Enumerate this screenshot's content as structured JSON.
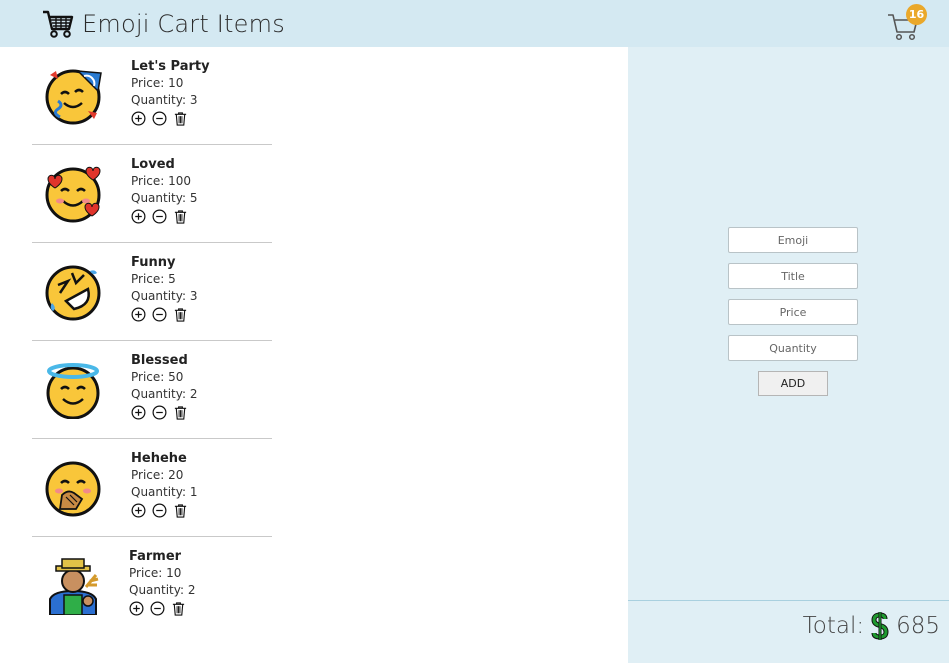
{
  "header": {
    "title": "Emoji Cart Items",
    "cart_count": "16",
    "brand_icon": "shopping-cart-icon",
    "cart_icon": "cart-outline-icon"
  },
  "items": [
    {
      "name": "Let's Party",
      "price": "Price: 10",
      "quantity": "Quantity: 3",
      "icon": "party-face-icon"
    },
    {
      "name": "Loved",
      "price": "Price: 100",
      "quantity": "Quantity: 5",
      "icon": "smiling-face-with-hearts-icon"
    },
    {
      "name": "Funny",
      "price": "Price: 5",
      "quantity": "Quantity: 3",
      "icon": "rolling-on-floor-laughing-icon"
    },
    {
      "name": "Blessed",
      "price": "Price: 50",
      "quantity": "Quantity: 2",
      "icon": "halo-face-icon"
    },
    {
      "name": "Hehehe",
      "price": "Price: 20",
      "quantity": "Quantity: 1",
      "icon": "hand-over-mouth-icon"
    },
    {
      "name": "Farmer",
      "price": "Price: 10",
      "quantity": "Quantity: 2",
      "icon": "farmer-icon"
    }
  ],
  "form": {
    "emoji_placeholder": "Emoji",
    "title_placeholder": "Title",
    "price_placeholder": "Price",
    "quantity_placeholder": "Quantity",
    "add_label": "ADD"
  },
  "total": {
    "label": "Total:",
    "value": "685",
    "currency_icon": "dollar-sign-icon"
  },
  "colors": {
    "header_bg": "#d4e9f2",
    "panel_bg": "#e0eff5",
    "badge": "#eaa82a",
    "dollar": "#1f9a2f"
  }
}
